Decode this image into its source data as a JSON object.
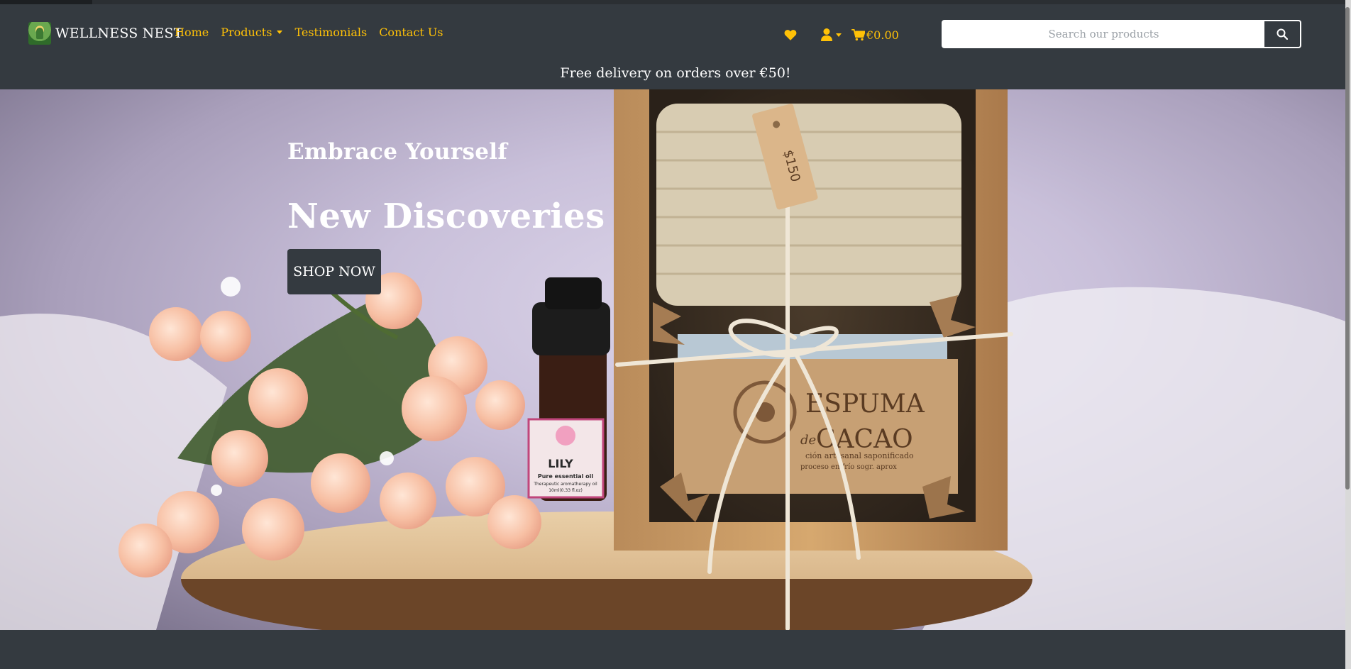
{
  "brand": {
    "name": "WELLNESS NEST",
    "logo_icon": "meditation-logo-icon"
  },
  "nav": {
    "items": [
      {
        "label": "Home"
      },
      {
        "label": "Products",
        "has_dropdown": true
      },
      {
        "label": "Testimonials"
      },
      {
        "label": "Contact Us"
      }
    ]
  },
  "header_icons": {
    "wishlist_icon": "heart-icon",
    "account_icon": "user-icon",
    "cart_icon": "shopping-cart-icon",
    "cart_total": "€0.00"
  },
  "search": {
    "placeholder": "Search our products",
    "value": "",
    "button_icon": "search-icon"
  },
  "promo_banner": {
    "text": "Free delivery on orders over €50!"
  },
  "hero": {
    "subtitle": "Embrace Yourself",
    "title": "New Discoveries",
    "cta_label": "SHOP NOW",
    "image_text": {
      "price_tag": "$150",
      "soap_brand_line1": "ESPUMA",
      "soap_brand_de": "de",
      "soap_brand_line2": "CACAO",
      "soap_desc_line1": "ción artesanal saponificado",
      "soap_desc_line2": "proceso en frío sogr. aprox",
      "oil_name": "LILY",
      "oil_desc_line1": "Pure essential oil",
      "oil_desc_line2": "Therapeutic aromatherapy oil",
      "oil_desc_line3": "10ml(0.33 fl.oz)"
    }
  },
  "colors": {
    "navbar_bg": "#343a40",
    "accent": "#ffc107",
    "text_light": "#ffffff"
  }
}
